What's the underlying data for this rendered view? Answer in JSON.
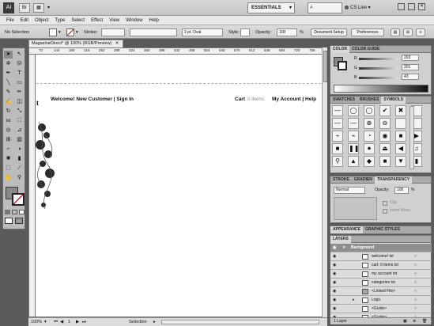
{
  "app": {
    "logo": "Ai",
    "workspace": "ESSENTIALS",
    "cs_live": "CS Live",
    "search_glyph": "⌕"
  },
  "menus": [
    "File",
    "Edit",
    "Object",
    "Type",
    "Select",
    "Effect",
    "View",
    "Window",
    "Help"
  ],
  "control_bar": {
    "selection": "No Selection",
    "stroke_label": "Stroke:",
    "brush": "2 pt. Oval",
    "style_label": "Style:",
    "opacity_label": "Opacity:",
    "opacity_value": "100",
    "opacity_unit": "%",
    "doc_setup": "Document Setup",
    "preferences": "Preferences"
  },
  "document": {
    "tab_title": "MagazineDirect* @ 100% (RGB/Preview)",
    "ruler_ticks": [
      "72",
      "144",
      "180",
      "216",
      "252",
      "288",
      "324",
      "360",
      "396",
      "432",
      "468",
      "504",
      "540",
      "576",
      "612",
      "648",
      "684",
      "720",
      "756"
    ],
    "header_left": "Welcome!  New Customer | Sign In",
    "cart_label": "Cart",
    "cart_items": "0 items",
    "account": "My Account | Help",
    "partial_letter": "t"
  },
  "status_bar": {
    "zoom": "100%",
    "page": "1",
    "tool": "Selection"
  },
  "color_panel": {
    "tabs": [
      "COLOR",
      "COLOR GUIDE"
    ],
    "r_label": "R",
    "r_value": "203",
    "g_label": "G",
    "g_value": "201",
    "b_label": "B",
    "b_value": "43"
  },
  "symbols_panel": {
    "tabs": [
      "SWATCHES",
      "BRUSHES",
      "SYMBOLS"
    ],
    "glyphs": [
      "—",
      "◯",
      "◯",
      "✔",
      "✖",
      "",
      "—",
      "—",
      "⊕",
      "⊖",
      "",
      "",
      "⌁",
      "⌁",
      "◔",
      "◉",
      "■",
      "▶",
      "■",
      "❚❚",
      "⏺",
      "⏏",
      "◀",
      "♫",
      "⚲",
      "▲",
      "◆",
      "■",
      "▼",
      "▮"
    ]
  },
  "transparency_panel": {
    "tabs": [
      "STROKE",
      "GRADIEN",
      "TRANSPARENCY"
    ],
    "mode": "Normal",
    "opacity_label": "Opacity:",
    "opacity_value": "100",
    "opacity_unit": "%",
    "clip": "Clip",
    "invert": "Invert Mask"
  },
  "appearance_panel": {
    "tabs": [
      "APPEARANCE",
      "GRAPHIC STYLES"
    ]
  },
  "layers_panel": {
    "tab": "LAYERS",
    "rows": [
      "Background",
      "welcome! txt",
      "cart: 0 items txt",
      "my account txt",
      "categories txt",
      "<Linked File>",
      "Logo",
      "<Guide>",
      "<Guide>"
    ],
    "footer": "1 Layer"
  }
}
